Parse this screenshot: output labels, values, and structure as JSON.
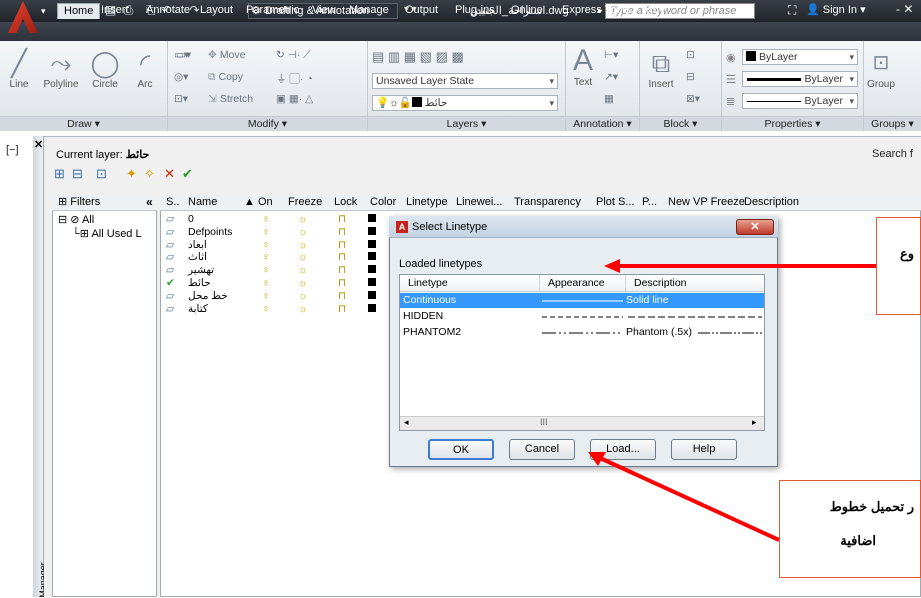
{
  "titlebar": {
    "workspace": "Drafting & Annotation",
    "document": "استراحة_الجنيين.dwg",
    "search_placeholder": "Type a keyword or phrase",
    "sign_in": "Sign In"
  },
  "tabs": [
    "Home",
    "Insert",
    "Annotate",
    "Layout",
    "Parametric",
    "View",
    "Manage",
    "Output",
    "Plug-ins",
    "Online",
    "Express Tools"
  ],
  "ribbon": {
    "draw": {
      "line": "Line",
      "polyline": "Polyline",
      "circle": "Circle",
      "arc": "Arc",
      "label": "Draw"
    },
    "modify": {
      "move": "Move",
      "copy": "Copy",
      "stretch": "Stretch",
      "label": "Modify"
    },
    "layers": {
      "state": "Unsaved Layer State",
      "layer": "حائط",
      "label": "Layers"
    },
    "annotation": {
      "text": "Text",
      "label": "Annotation"
    },
    "block": {
      "insert": "Insert",
      "label": "Block"
    },
    "properties": {
      "color": "ByLayer",
      "lineweight": "ByLayer",
      "linetype": "ByLayer",
      "label": "Properties"
    },
    "groups": {
      "group": "Group",
      "label": "Groups"
    }
  },
  "palette": {
    "viewport_label": "[−]",
    "manager_label": "Manager",
    "current_layer_label": "Current layer:",
    "current_layer": "حائط",
    "search": "Search f",
    "filters_header": "Filters",
    "filter_all": "All",
    "filter_used": "All Used L",
    "columns": [
      "S..",
      "Name",
      "On",
      "Freeze",
      "Lock",
      "Color",
      "Linetype",
      "Linewei...",
      "Transparency",
      "Plot S...",
      "P...",
      "New VP Freeze",
      "Description"
    ],
    "layers": [
      "0",
      "Defpoints",
      "ابعاد",
      "اثاث",
      "تهشير",
      "حائط",
      "خط محل",
      "كتابة"
    ]
  },
  "dialog": {
    "title": "Select Linetype",
    "loaded_label": "Loaded linetypes",
    "col_linetype": "Linetype",
    "col_appearance": "Appearance",
    "col_description": "Description",
    "linetypes": [
      {
        "name": "Continuous",
        "description": "Solid line",
        "selected": true
      },
      {
        "name": "HIDDEN",
        "description": "",
        "selected": false
      },
      {
        "name": "PHANTOM2",
        "description": "Phantom (.5x)",
        "selected": false
      }
    ],
    "scroll_mark": "III",
    "ok": "OK",
    "cancel": "Cancel",
    "load": "Load...",
    "help": "Help"
  },
  "annotations": {
    "box1": "وع",
    "box2_line1": "ر تحميل خطوط",
    "box2_line2": "اضافية",
    "arrow_color": "#ff0000"
  }
}
